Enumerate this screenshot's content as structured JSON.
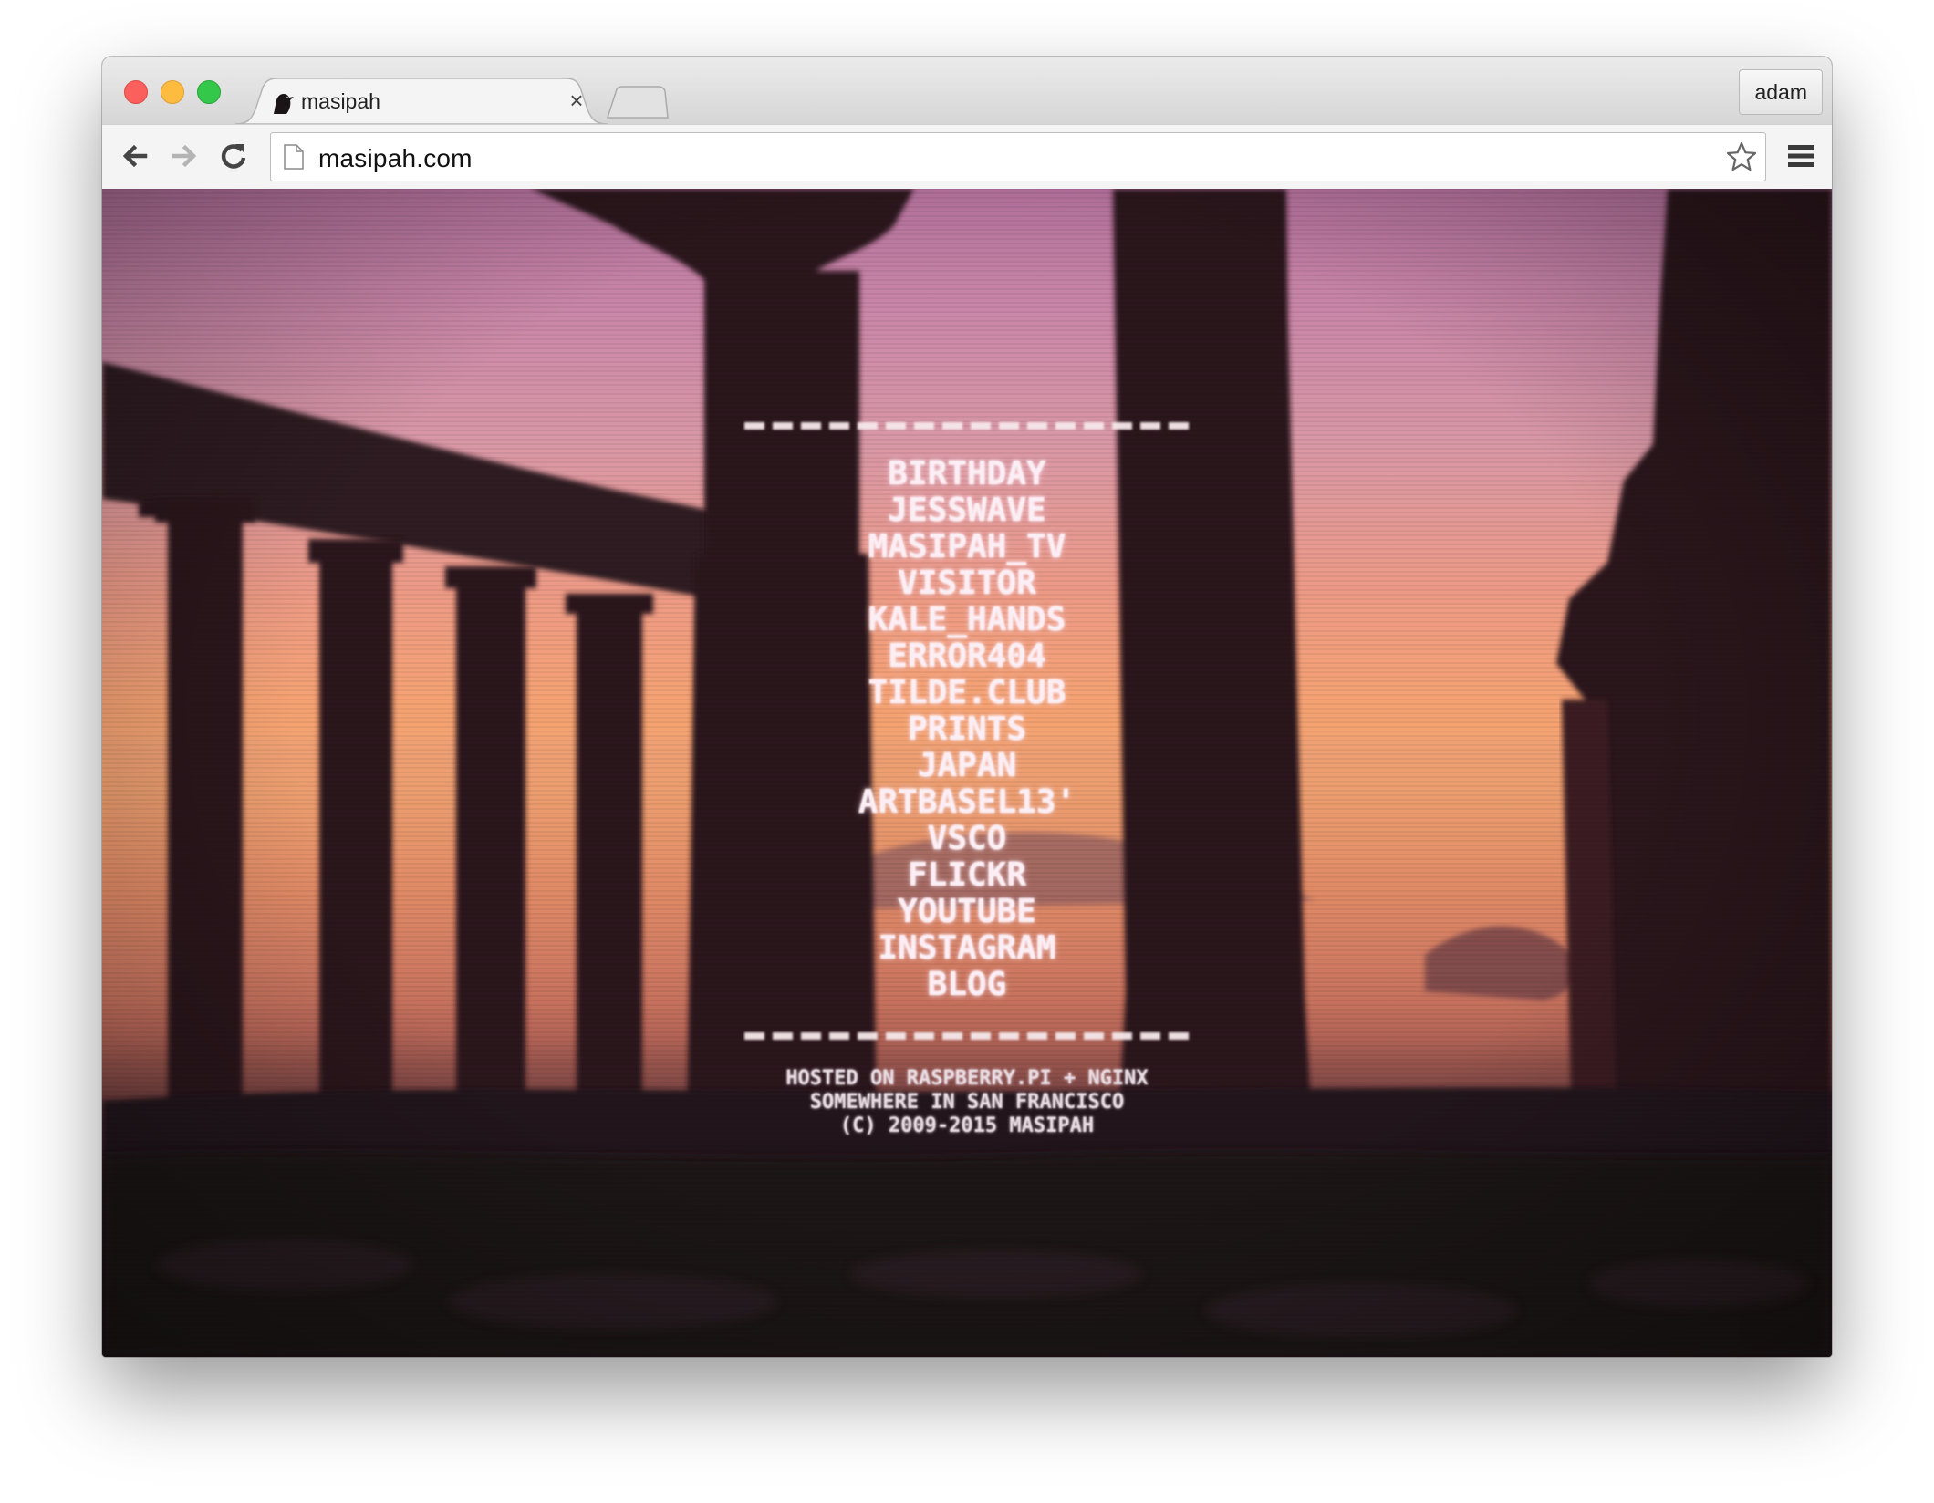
{
  "browser": {
    "tab_title": "masipah",
    "url": "masipah.com",
    "profile_name": "adam"
  },
  "page": {
    "menu_items": [
      "BIRTHDAY",
      "JESSWAVE",
      "MASIPAH_TV",
      "VISITOR",
      "KALE_HANDS",
      "ERROR404",
      "TILDE.CLUB",
      "PRINTS",
      "JAPAN",
      "ARTBASEL13'",
      "VSCO",
      "FLICKR",
      "YOUTUBE",
      "INSTAGRAM",
      "BLOG"
    ],
    "footer": {
      "line1": "HOSTED ON RASPBERRY.PI + NGINX",
      "line2": "SOMEWHERE IN SAN FRANCISCO",
      "line3": "(C) 2009-2015 MASIPAH"
    }
  },
  "colors": {
    "traffic_close": "#fc605c",
    "traffic_minimize": "#fdbc40",
    "traffic_maximize": "#34c84a",
    "menu_text": "#fbeef4",
    "sunset_orange": "#f6a46a",
    "sky_pink": "#c986a8",
    "column_silhouette": "#2a1a1e"
  },
  "icons": {
    "favicon": "bird-silhouette-icon",
    "back": "arrow-left-icon",
    "forward": "arrow-right-icon",
    "reload": "reload-icon",
    "page": "page-icon",
    "bookmark": "star-icon",
    "menu": "hamburger-menu-icon"
  }
}
